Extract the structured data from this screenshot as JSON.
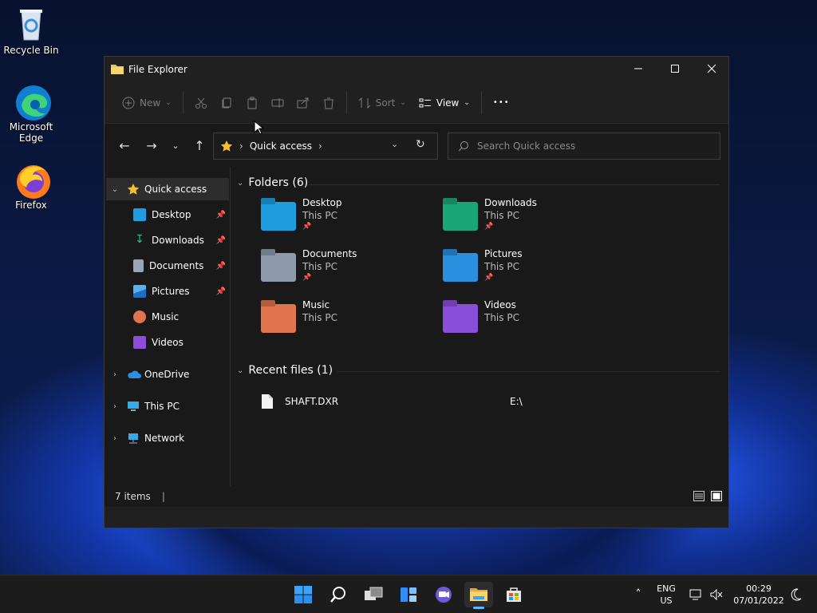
{
  "desktop": {
    "icons": [
      {
        "label": "Recycle Bin",
        "icon": "recycle-bin-icon"
      },
      {
        "label": "Microsoft Edge",
        "icon": "edge-icon"
      },
      {
        "label": "Firefox",
        "icon": "firefox-icon"
      }
    ]
  },
  "window": {
    "title": "File Explorer",
    "toolbar": {
      "new_label": "New",
      "sort_label": "Sort",
      "view_label": "View",
      "more_label": "•••"
    },
    "address": {
      "location": "Quick access"
    },
    "search": {
      "placeholder": "Search Quick access"
    },
    "sidebar": {
      "quick_access": "Quick access",
      "pinned": [
        "Desktop",
        "Downloads",
        "Documents",
        "Pictures"
      ],
      "music": "Music",
      "videos": "Videos",
      "onedrive": "OneDrive",
      "this_pc": "This PC",
      "network": "Network"
    },
    "folders_header": "Folders (6)",
    "folders": [
      {
        "name": "Desktop",
        "location": "This PC",
        "pinned": true,
        "color": "#1e9de0"
      },
      {
        "name": "Downloads",
        "location": "This PC",
        "pinned": true,
        "color": "#1ba678"
      },
      {
        "name": "Documents",
        "location": "This PC",
        "pinned": true,
        "color": "#8e9aab"
      },
      {
        "name": "Pictures",
        "location": "This PC",
        "pinned": true,
        "color": "#2b8fe0"
      },
      {
        "name": "Music",
        "location": "This PC",
        "pinned": false,
        "color": "#e0744f"
      },
      {
        "name": "Videos",
        "location": "This PC",
        "pinned": false,
        "color": "#8a4fd8"
      }
    ],
    "recent_header": "Recent files (1)",
    "recent": [
      {
        "name": "SHAFT.DXR",
        "path": "E:\\"
      }
    ],
    "status": "7 items"
  },
  "taskbar": {
    "lang": "ENG",
    "region": "US",
    "time": "00:29",
    "date": "07/01/2022"
  }
}
